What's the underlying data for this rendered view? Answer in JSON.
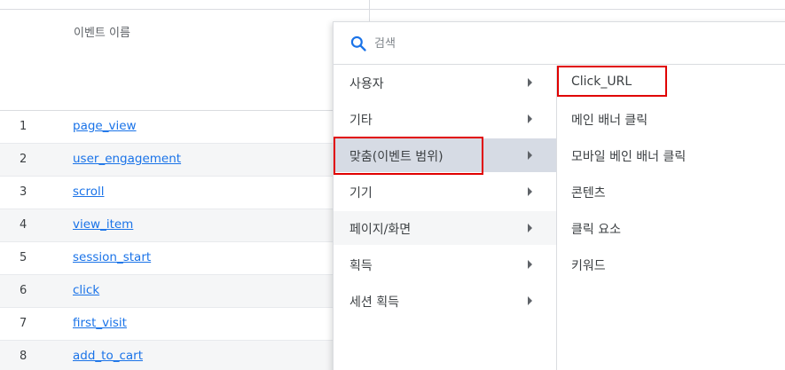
{
  "table": {
    "header_label": "이벤트 이름",
    "rows": [
      {
        "num": "1",
        "name": "page_view"
      },
      {
        "num": "2",
        "name": "user_engagement"
      },
      {
        "num": "3",
        "name": "scroll"
      },
      {
        "num": "4",
        "name": "view_item"
      },
      {
        "num": "5",
        "name": "session_start"
      },
      {
        "num": "6",
        "name": "click"
      },
      {
        "num": "7",
        "name": "first_visit"
      },
      {
        "num": "8",
        "name": "add_to_cart"
      }
    ]
  },
  "menu": {
    "search": {
      "placeholder": "검색",
      "value": ""
    },
    "categories": [
      {
        "label": "사용자"
      },
      {
        "label": "기타"
      },
      {
        "label": "맞춤(이벤트 범위)"
      },
      {
        "label": "기기"
      },
      {
        "label": "페이지/화면"
      },
      {
        "label": "획득"
      },
      {
        "label": "세션 획득"
      }
    ],
    "selected_category": "맞춤(이벤트 범위)",
    "sub_items": [
      {
        "label": "Click_URL"
      },
      {
        "label": "메인 배너 클릭"
      },
      {
        "label": "모바일 베인 배너 클릭"
      },
      {
        "label": "콘텐츠"
      },
      {
        "label": "클릭 요소"
      },
      {
        "label": "키워드"
      }
    ]
  },
  "colors": {
    "link": "#1a73e8",
    "selected_bg": "#d6dbe4",
    "highlight": "#e00000",
    "search_icon": "#1a73e8"
  },
  "icons": {
    "search": "search-icon",
    "submenu_arrow": "chevron-right-icon"
  }
}
